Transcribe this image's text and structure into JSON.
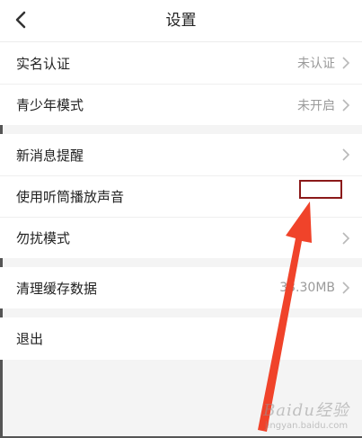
{
  "header": {
    "title": "设置",
    "back_icon": "chevron-left-icon"
  },
  "groups": [
    {
      "items": [
        {
          "label": "实名认证",
          "value": "未认证",
          "chevron": true
        },
        {
          "label": "青少年模式",
          "value": "未开启",
          "chevron": true
        }
      ]
    },
    {
      "items": [
        {
          "label": "新消息提醒",
          "value": "",
          "chevron": true
        },
        {
          "label": "使用听筒播放声音",
          "value": "",
          "chevron": false
        },
        {
          "label": "勿扰模式",
          "value": "",
          "chevron": true
        }
      ]
    },
    {
      "items": [
        {
          "label": "清理缓存数据",
          "value": "33.30MB",
          "chevron": true
        }
      ]
    },
    {
      "items": [
        {
          "label": "退出",
          "value": "",
          "chevron": false
        }
      ]
    }
  ],
  "annotation": {
    "highlight_color": "#8b1a1a",
    "arrow_color": "#f0432a"
  },
  "watermark": {
    "main": "Baidu经验",
    "sub": "jingyan.baidu.com"
  }
}
